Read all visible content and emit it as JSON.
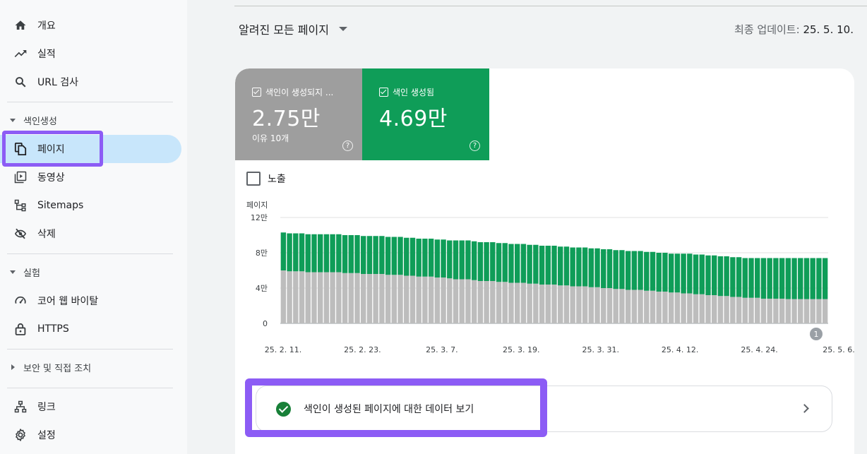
{
  "sidebar": {
    "items_top": [
      {
        "label": "개요",
        "icon": "home-icon"
      },
      {
        "label": "실적",
        "icon": "trending-up-icon"
      },
      {
        "label": "URL 검사",
        "icon": "search-icon"
      }
    ],
    "section_indexing": {
      "label": "색인생성",
      "expanded": true
    },
    "items_indexing": [
      {
        "label": "페이지",
        "icon": "pages-icon",
        "active": true
      },
      {
        "label": "동영상",
        "icon": "video-icon"
      },
      {
        "label": "Sitemaps",
        "icon": "sitemap-icon"
      },
      {
        "label": "삭제",
        "icon": "visibility-off-icon"
      }
    ],
    "section_experience": {
      "label": "실험",
      "expanded": true
    },
    "items_experience": [
      {
        "label": "코어 웹 바이탈",
        "icon": "speed-gauge-icon"
      },
      {
        "label": "HTTPS",
        "icon": "lock-icon"
      }
    ],
    "section_security": {
      "label": "보안 및 직접 조치",
      "expanded": false
    },
    "items_bottom": [
      {
        "label": "링크",
        "icon": "links-icon"
      },
      {
        "label": "설정",
        "icon": "settings-icon"
      }
    ],
    "highlight_color": "#8c5cf5",
    "active_color": "#c8e6fb"
  },
  "header": {
    "scope_label": "알려진 모든 페이지",
    "last_update_prefix": "최종 업데이트:",
    "last_update_value": "25. 5. 10."
  },
  "tiles": {
    "not_indexed": {
      "label": "색인이 생성되지 ...",
      "value": "2.75만",
      "sub": "이유 10개",
      "color": "#9e9e9e"
    },
    "indexed": {
      "label": "색인 생성됨",
      "value": "4.69만",
      "color": "#0f9d58"
    }
  },
  "impressions": {
    "label": "노출",
    "checked": false
  },
  "chart_data": {
    "type": "bar",
    "stacked": true,
    "ylabel": "페이지",
    "ylim": [
      0,
      120000
    ],
    "y_ticks": [
      {
        "value": 0,
        "label": "0"
      },
      {
        "value": 40000,
        "label": "4만"
      },
      {
        "value": 80000,
        "label": "8만"
      },
      {
        "value": 120000,
        "label": "12만"
      }
    ],
    "x_tick_labels": [
      "25. 2. 11.",
      "25. 2. 23.",
      "25. 3. 7.",
      "25. 3. 19.",
      "25. 3. 31.",
      "25. 4. 12.",
      "25. 4. 24.",
      "25. 5. 6."
    ],
    "x_start": "25. 2. 11.",
    "x_end": "25. 5. 10.",
    "annotation": "1",
    "series": [
      {
        "name": "색인이 생성되지 않음",
        "color": "#bdbdbd",
        "values": [
          60000,
          59000,
          59000,
          59000,
          58000,
          58000,
          58000,
          58000,
          58000,
          58000,
          57000,
          57000,
          57000,
          56000,
          56000,
          56000,
          56000,
          55000,
          55000,
          55000,
          54000,
          54000,
          53000,
          53000,
          53000,
          52000,
          52000,
          51000,
          50000,
          50000,
          50000,
          49000,
          48000,
          48000,
          48000,
          47000,
          47000,
          46000,
          46000,
          46000,
          45000,
          45000,
          44000,
          44000,
          44000,
          43000,
          43000,
          42000,
          42000,
          42000,
          41000,
          41000,
          40000,
          40000,
          39000,
          39000,
          38000,
          38000,
          38000,
          37000,
          37000,
          36000,
          36000,
          35000,
          35000,
          34000,
          34000,
          33000,
          33000,
          32000,
          32000,
          31000,
          31000,
          30000,
          30000,
          29000,
          29000,
          29000,
          28000,
          28000,
          28000,
          28000,
          27500,
          27500,
          27500,
          27500,
          27500,
          27500,
          27500
        ]
      },
      {
        "name": "색인 생성됨",
        "color": "#0f9d58",
        "values": [
          43000,
          43000,
          43000,
          43000,
          43000,
          43000,
          43000,
          43000,
          43000,
          43000,
          43000,
          43000,
          43000,
          43000,
          43000,
          43000,
          43000,
          43000,
          43000,
          43000,
          43000,
          43000,
          43000,
          43000,
          43000,
          43000,
          43000,
          43000,
          44000,
          44000,
          44000,
          44000,
          44000,
          44000,
          44000,
          44000,
          44000,
          44000,
          44000,
          44000,
          44000,
          44000,
          44000,
          44000,
          44000,
          44000,
          44000,
          44000,
          44000,
          44000,
          44000,
          44000,
          44000,
          44000,
          44000,
          44000,
          44000,
          44000,
          44000,
          44000,
          44000,
          44000,
          44000,
          44000,
          44000,
          45000,
          45000,
          45000,
          45000,
          45000,
          45000,
          45000,
          45000,
          45000,
          45000,
          45000,
          45000,
          45000,
          46000,
          46000,
          46000,
          46000,
          46500,
          46500,
          46500,
          46500,
          46500,
          46500,
          46500
        ]
      }
    ],
    "grid": true,
    "legend": "none"
  },
  "cta": {
    "label": "색인이 생성된 페이지에 대한 데이터 보기",
    "icon": "check-circle-icon"
  }
}
